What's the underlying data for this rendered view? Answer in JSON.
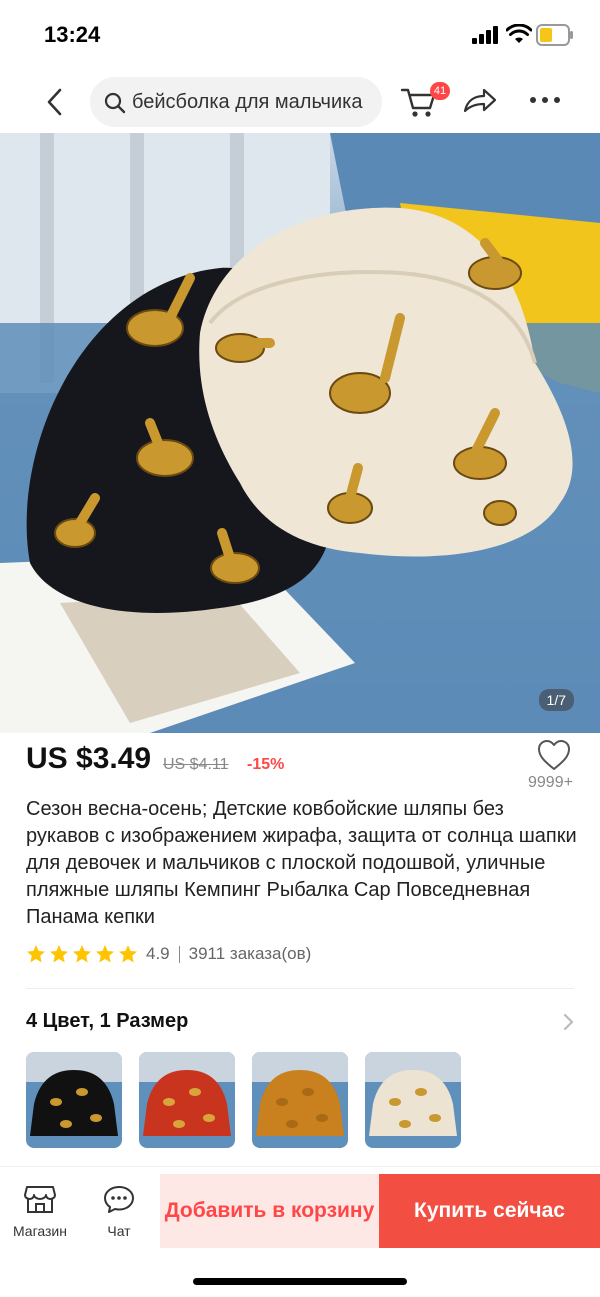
{
  "status_bar": {
    "time": "13:24"
  },
  "nav": {
    "search_value": "бейсболка для мальчика",
    "cart_count": "41",
    "icons": [
      "back-icon",
      "search-icon",
      "cart-icon",
      "share-icon",
      "more-icon"
    ]
  },
  "gallery": {
    "counter": "1/7"
  },
  "product": {
    "price": "US $3.49",
    "old_price": "US $4.11",
    "discount": "-15%",
    "wishlist_count": "9999+",
    "title": "Сезон весна-осень; Детские ковбойские шляпы без рукавов с изображением жирафа, защита от солнца шапки для девочек и мальчиков с плоской подошвой, уличные пляжные шляпы Кемпинг Рыбалка Cap Повседневная Панама кепки",
    "rating": "4.9",
    "rating_stars": 5,
    "orders": "3911 заказа(ов)"
  },
  "variants": {
    "title": "4 Цвет, 1 Размер",
    "swatches": [
      "black",
      "red",
      "orange",
      "beige"
    ]
  },
  "bottom_bar": {
    "store_label": "Магазин",
    "chat_label": "Чат",
    "add_to_cart": "Добавить в корзину",
    "buy_now": "Купить сейчас"
  },
  "colors": {
    "accent": "#ff4747",
    "buy_button": "#f34e42",
    "cart_button_bg": "#fde8e6",
    "star": "#ffc400"
  }
}
